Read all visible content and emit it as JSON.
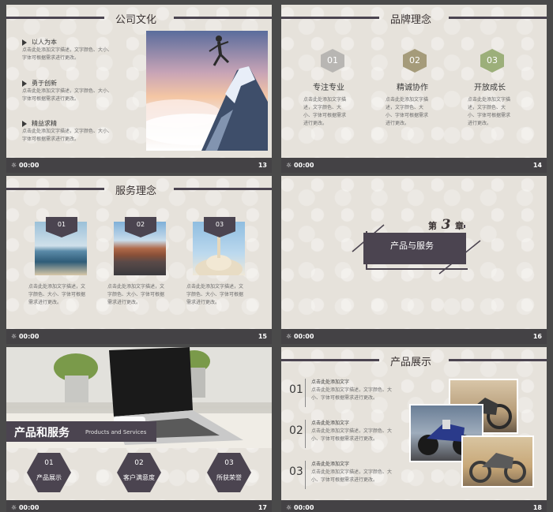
{
  "footer": {
    "time": "00:00"
  },
  "slide13": {
    "title": "公司文化",
    "items": [
      {
        "label": "以人为本",
        "text1": "点击此处添加文字描述，文字颜色、大小、",
        "text2": "字体可根据需求进行更改。"
      },
      {
        "label": "勇于创新",
        "text1": "点击此处添加文字描述，文字颜色、大小、",
        "text2": "字体可根据需求进行更改。"
      },
      {
        "label": "精益求精",
        "text1": "点击此处添加文字描述，文字颜色、大小、",
        "text2": "字体可根据需求进行更改。"
      }
    ],
    "page": "13"
  },
  "slide14": {
    "title": "品牌理念",
    "cols": [
      {
        "num": "01",
        "color": "#b8b6b3",
        "label": "专注专业",
        "lines": [
          "点击此处添加文字描",
          "述，文字颜色、大",
          "小、字体可根据需求",
          "进行更改。"
        ]
      },
      {
        "num": "02",
        "color": "#a59b7a",
        "label": "精诚协作",
        "lines": [
          "点击此处添加文字描",
          "述，文字颜色、大",
          "小、字体可根据需求",
          "进行更改。"
        ]
      },
      {
        "num": "03",
        "color": "#9caf7a",
        "label": "开放成长",
        "lines": [
          "点击此处添加文字描",
          "述，文字颜色、大",
          "小、字体可根据需求",
          "进行更改。"
        ]
      }
    ],
    "page": "14"
  },
  "slide15": {
    "title": "服务理念",
    "cols": [
      {
        "num": "01",
        "lines": [
          "点击此处添加文字描述，文",
          "字颜色、大小、字体可根据",
          "需求进行更改。"
        ]
      },
      {
        "num": "02",
        "lines": [
          "点击此处添加文字描述，文",
          "字颜色、大小、字体可根据",
          "需求进行更改。"
        ]
      },
      {
        "num": "03",
        "lines": [
          "点击此处添加文字描述，文",
          "字颜色、大小、字体可根据",
          "需求进行更改。"
        ]
      }
    ],
    "page": "15"
  },
  "slide16": {
    "chapter_prefix": "第",
    "chapter_num": "3",
    "chapter_suffix": "章",
    "title": "产品与服务",
    "page": "16"
  },
  "slide17": {
    "title": "产品和服务",
    "subtitle": "Products and Services",
    "items": [
      {
        "num": "01",
        "label": "产品展示"
      },
      {
        "num": "02",
        "label": "客户满意度"
      },
      {
        "num": "03",
        "label": "所获荣誉"
      }
    ],
    "page": "17"
  },
  "slide18": {
    "title": "产品展示",
    "rows": [
      {
        "num": "01",
        "head": "点击此处添加文字",
        "l1": "点击此处添加文字描述，文字颜色、大",
        "l2": "小、字体可根据需求进行更改。"
      },
      {
        "num": "02",
        "head": "点击此处添加文字",
        "l1": "点击此处添加文字描述，文字颜色、大",
        "l2": "小、字体可根据需求进行更改。"
      },
      {
        "num": "03",
        "head": "点击此处添加文字",
        "l1": "点击此处添加文字描述，文字颜色、大",
        "l2": "小、字体可根据需求进行更改。"
      }
    ],
    "page": "18"
  }
}
